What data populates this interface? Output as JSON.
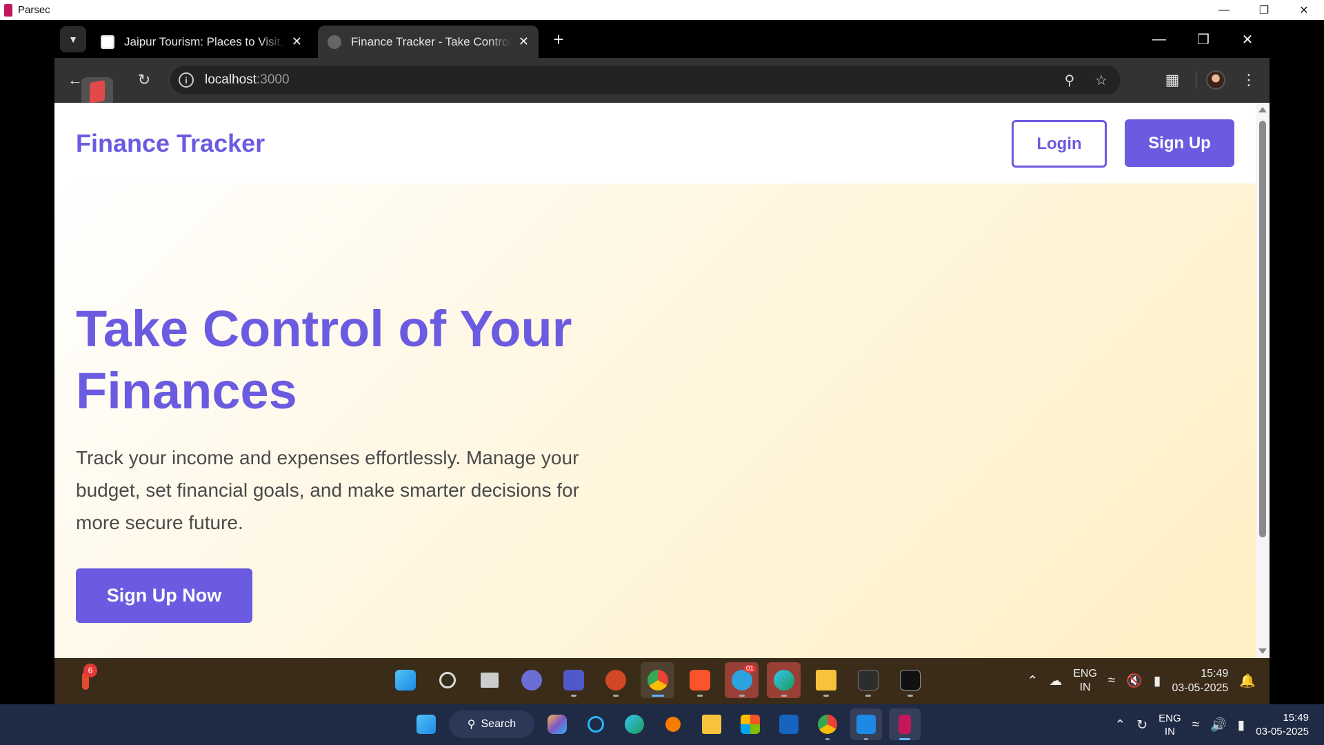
{
  "parsec": {
    "title": "Parsec"
  },
  "browser": {
    "tabs": [
      {
        "title": "Jaipur Tourism: Places to Visit, S",
        "active": false
      },
      {
        "title": "Finance Tracker - Take Control c",
        "active": true
      }
    ],
    "url_host": "localhost",
    "url_port": ":3000"
  },
  "site": {
    "brand": "Finance Tracker",
    "login_label": "Login",
    "signup_label": "Sign Up",
    "hero_title": "Take Control of Your Finances",
    "hero_description": "Track your income and expenses effortlessly. Manage your budget, set financial goals, and make smarter decisions for more secure future.",
    "cta_label": "Sign Up Now",
    "accent_color": "#6b5be0"
  },
  "remote_taskbar": {
    "weather_badge": "6",
    "telegram_badge": "01",
    "lang_line1": "ENG",
    "lang_line2": "IN",
    "time": "15:49",
    "date": "03-05-2025"
  },
  "host_taskbar": {
    "search_label": "Search",
    "lang_line1": "ENG",
    "lang_line2": "IN",
    "time": "15:49",
    "date": "03-05-2025"
  }
}
